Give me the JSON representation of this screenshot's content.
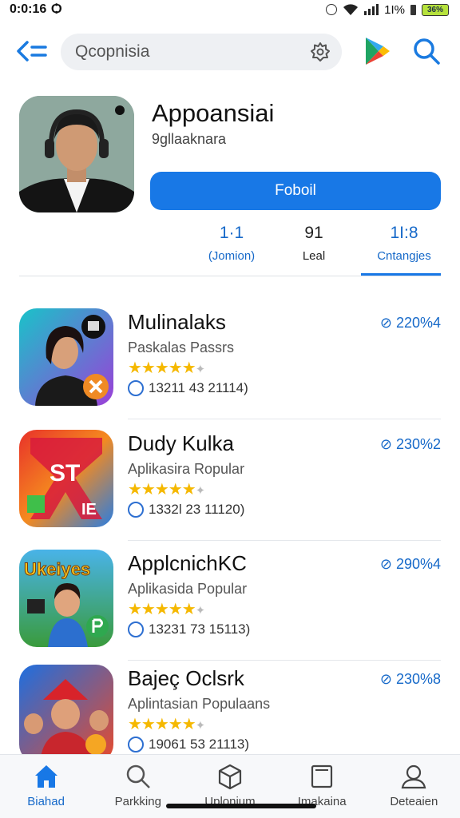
{
  "status_bar": {
    "time": "0:0:16",
    "carrier_glyph": "Ѻ",
    "network": "1I%",
    "battery": "36%"
  },
  "search": {
    "value": "Qcopnisia"
  },
  "profile": {
    "title": "Appoansiai",
    "subtitle": "9gllaaknara",
    "follow_label": "Foboil",
    "stats": [
      {
        "value": "1·1",
        "label": "(Jomion)"
      },
      {
        "value": "91",
        "label": "Leal"
      },
      {
        "value": "1I:8",
        "label": "Cntangjes"
      }
    ]
  },
  "apps": [
    {
      "name": "Mulinalaks",
      "category": "Paskalas Passrs",
      "stats": "13211 43 21114)",
      "percent": "⊘ 220%4",
      "rating": 4.5
    },
    {
      "name": "Dudy Kulka",
      "category": "Aplikasira Ropular",
      "stats": "1332l 23 11120)",
      "percent": "⊘ 230%2",
      "rating": 4.5
    },
    {
      "name": "ApplcnichKC",
      "category": "Aplikasida Popular",
      "stats": "13231 73 15113)",
      "percent": "⊘ 290%4",
      "rating": 4.5
    },
    {
      "name": "Bajeç Oclsrk",
      "category": "Aplintasian Populaans",
      "stats": "19061 53 21113)",
      "percent": "⊘ 230%8",
      "rating": 4.5
    }
  ],
  "app_icon_text": {
    "icon2": "ST",
    "icon2_corner": "IE",
    "icon3": "Ukeiyes"
  },
  "bottom_nav": [
    {
      "label": "Biahad",
      "icon": "home-icon",
      "active": true
    },
    {
      "label": "Parkking",
      "icon": "search-icon",
      "active": false
    },
    {
      "label": "Uplonium",
      "icon": "box-icon",
      "active": false
    },
    {
      "label": "Imakaina",
      "icon": "tablet-icon",
      "active": false
    },
    {
      "label": "Deteaien",
      "icon": "profile-icon",
      "active": false
    }
  ],
  "colors": {
    "accent": "#1878e6",
    "accent_text": "#1669c9",
    "star": "#f5b800"
  }
}
